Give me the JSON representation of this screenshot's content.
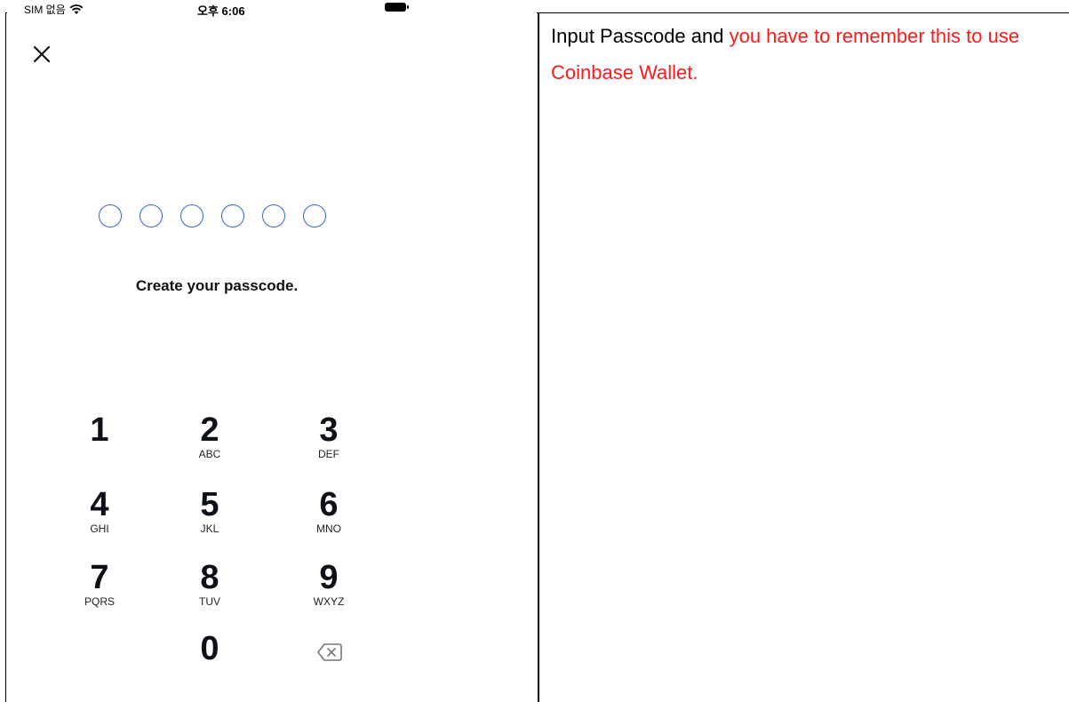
{
  "status": {
    "carrier": "SIM 없음",
    "time": "오후 6:06"
  },
  "passcode": {
    "dots": 6,
    "prompt": "Create your passcode."
  },
  "keypad": [
    {
      "num": "1",
      "letters": ""
    },
    {
      "num": "2",
      "letters": "ABC"
    },
    {
      "num": "3",
      "letters": "DEF"
    },
    {
      "num": "4",
      "letters": "GHI"
    },
    {
      "num": "5",
      "letters": "JKL"
    },
    {
      "num": "6",
      "letters": "MNO"
    },
    {
      "num": "7",
      "letters": "PQRS"
    },
    {
      "num": "8",
      "letters": "TUV"
    },
    {
      "num": "9",
      "letters": "WXYZ"
    },
    {
      "num": "0",
      "letters": ""
    }
  ],
  "note": {
    "normal": "Input Passcode and ",
    "highlight": "you have to remember this to use Coinbase Wallet."
  },
  "colors": {
    "dot_border": "#3466d6",
    "highlight": "#ff1a1a"
  }
}
